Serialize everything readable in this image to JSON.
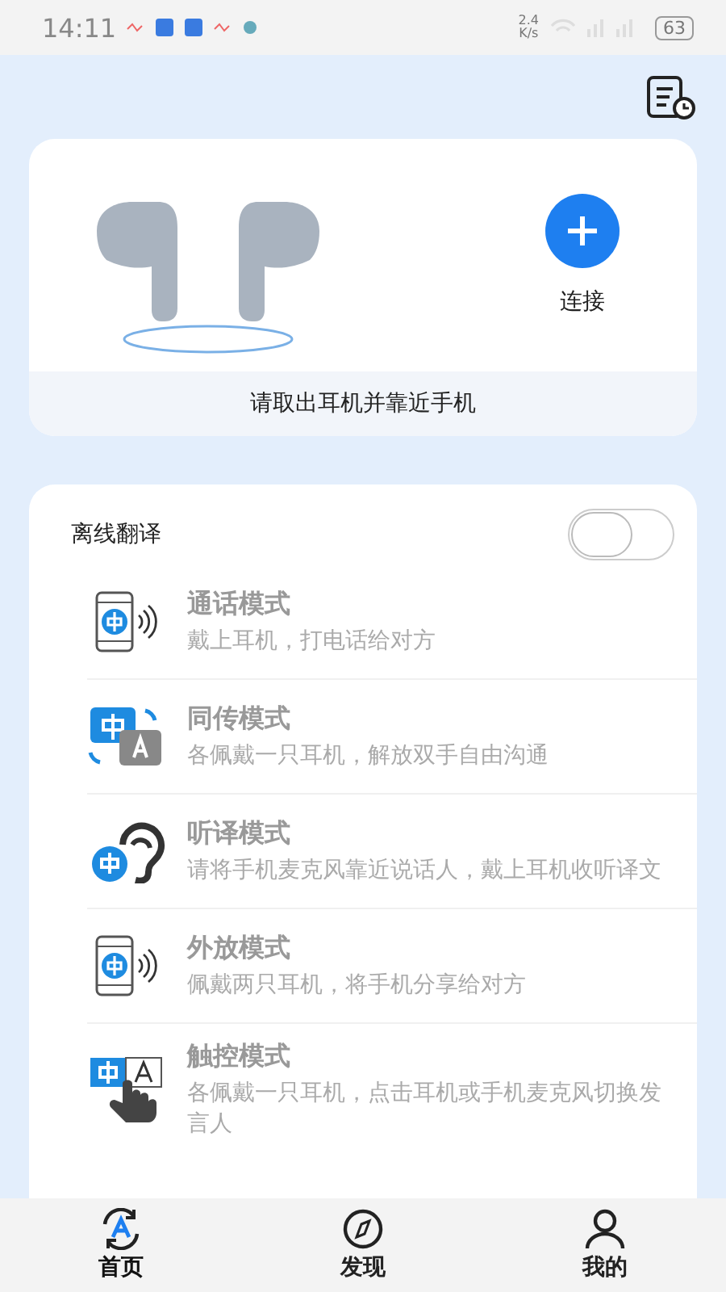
{
  "status_bar": {
    "time": "14:11",
    "speed": "2.4\nK/s",
    "battery": "63"
  },
  "device": {
    "connect_label": "连接",
    "hint": "请取出耳机并靠近手机"
  },
  "offline": {
    "label": "离线翻译",
    "on": false
  },
  "modes": [
    {
      "kind": "call",
      "title": "通话模式",
      "desc": "戴上耳机，打电话给对方"
    },
    {
      "kind": "simul",
      "title": "同传模式",
      "desc": "各佩戴一只耳机，解放双手自由沟通"
    },
    {
      "kind": "listen",
      "title": "听译模式",
      "desc": "请将手机麦克风靠近说话人，戴上耳机收听译文"
    },
    {
      "kind": "call",
      "title": "外放模式",
      "desc": "佩戴两只耳机，将手机分享给对方"
    },
    {
      "kind": "touch",
      "title": "触控模式",
      "desc": "各佩戴一只耳机，点击耳机或手机麦克风切换发言人"
    }
  ],
  "nav": [
    {
      "kind": "home",
      "label": "首页",
      "selected": true
    },
    {
      "kind": "discover",
      "label": "发现",
      "selected": false
    },
    {
      "kind": "me",
      "label": "我的",
      "selected": false
    }
  ]
}
